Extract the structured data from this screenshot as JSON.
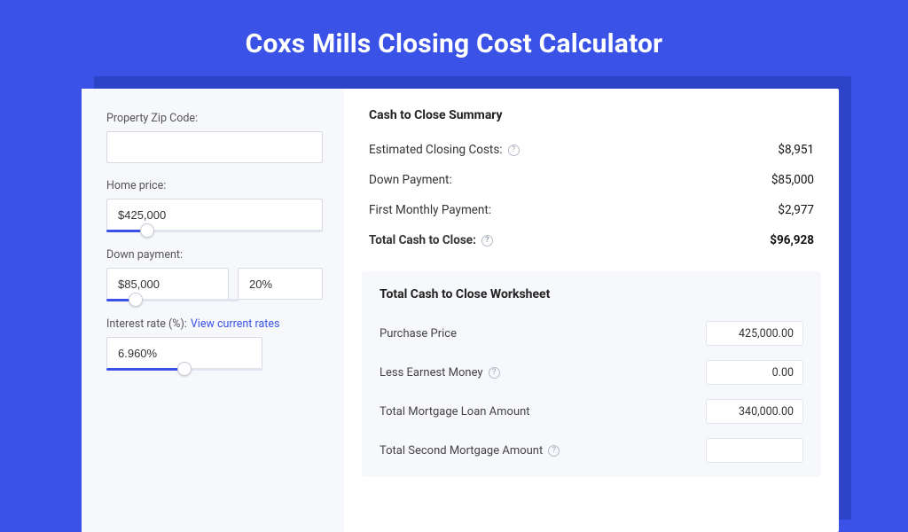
{
  "title": "Coxs Mills Closing Cost Calculator",
  "left": {
    "zip_label": "Property Zip Code:",
    "zip_value": "",
    "home_price_label": "Home price:",
    "home_price_value": "$425,000",
    "home_price_slider_pct": 19,
    "down_payment_label": "Down payment:",
    "down_payment_value": "$85,000",
    "down_payment_pct_value": "20%",
    "down_payment_slider_pct": 22,
    "interest_label_prefix": "Interest rate (%): ",
    "interest_link": "View current rates",
    "interest_value": "6.960%",
    "interest_slider_pct": 50
  },
  "summary": {
    "heading": "Cash to Close Summary",
    "rows": [
      {
        "label": "Estimated Closing Costs:",
        "has_help": true,
        "value": "$8,951",
        "strong": false
      },
      {
        "label": "Down Payment:",
        "has_help": false,
        "value": "$85,000",
        "strong": false
      },
      {
        "label": "First Monthly Payment:",
        "has_help": false,
        "value": "$2,977",
        "strong": false
      },
      {
        "label": "Total Cash to Close:",
        "has_help": true,
        "value": "$96,928",
        "strong": true
      }
    ]
  },
  "worksheet": {
    "heading": "Total Cash to Close Worksheet",
    "rows": [
      {
        "label": "Purchase Price",
        "has_help": false,
        "value": "425,000.00"
      },
      {
        "label": "Less Earnest Money",
        "has_help": true,
        "value": "0.00"
      },
      {
        "label": "Total Mortgage Loan Amount",
        "has_help": false,
        "value": "340,000.00"
      },
      {
        "label": "Total Second Mortgage Amount",
        "has_help": true,
        "value": ""
      }
    ]
  },
  "glyphs": {
    "help": "?"
  }
}
